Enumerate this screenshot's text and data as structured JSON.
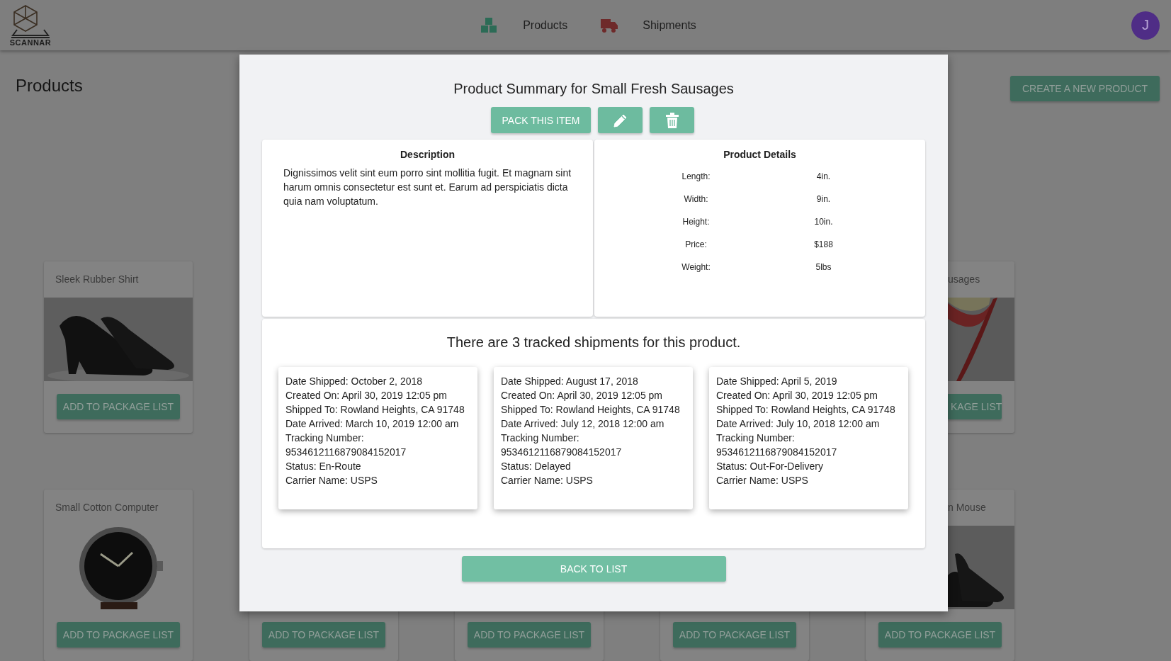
{
  "header": {
    "logo_text": "SCANNAR",
    "nav": [
      {
        "kind": "boxes",
        "label": "Products"
      },
      {
        "kind": "truck",
        "label": "Shipments"
      }
    ],
    "avatar": "J"
  },
  "page": {
    "title": "Products",
    "create_button": "CREATE A NEW PRODUCT"
  },
  "card_rows": [
    {
      "cards": [
        {
          "kind": "full",
          "title": "Sleek Rubber Shirt",
          "button": "ADD TO PACKAGE LIST",
          "button_clipped": false
        },
        {
          "kind": "right_clipped",
          "title": "usages",
          "button": "KAGE LIST",
          "button_clipped": true
        }
      ]
    },
    {
      "cards": [
        {
          "kind": "full",
          "title": "Small Cotton Computer",
          "button": "ADD TO PACKAGE LIST",
          "button_clipped": false
        },
        {
          "kind": "bottom_visible",
          "button": "ADD TO PACKAGE LIST",
          "button_clipped": false
        },
        {
          "kind": "bottom_visible",
          "button": "ADD TO PACKAGE LIST",
          "button_clipped": false
        },
        {
          "kind": "bottom_visible",
          "button": "ADD TO PACKAGE LIST",
          "button_clipped": false
        },
        {
          "kind": "right_clipped",
          "title": "n Mouse",
          "button": "ADD TO PACKAGE LIST",
          "button_clipped": false
        }
      ]
    }
  ],
  "modal": {
    "title": "Product Summary for Small Fresh Sausages",
    "actions": [
      {
        "kind": "text",
        "label": "PACK THIS ITEM"
      },
      {
        "kind": "edit"
      },
      {
        "kind": "delete"
      }
    ],
    "description": {
      "heading": "Description",
      "text": "Dignissimos velit sint eum porro sint mollitia fugit. Et magnam sint harum omnis consectetur est sunt et. Earum ad perspiciatis dicta quia nam voluptatum."
    },
    "details": {
      "heading": "Product Details",
      "rows": [
        {
          "label": "Length:",
          "value": "4in."
        },
        {
          "label": "Width:",
          "value": "9in."
        },
        {
          "label": "Height:",
          "value": "10in."
        },
        {
          "label": "Price:",
          "value": "$188"
        },
        {
          "label": "Weight:",
          "value": "5lbs"
        }
      ]
    },
    "shipments": {
      "heading": "There are 3 tracked shipments for this product.",
      "items": [
        {
          "lines": [
            "Date Shipped: October 2, 2018",
            "Created On: April 30, 2019 12:05 pm",
            "Shipped To: Rowland Heights, CA 91748",
            "Date Arrived: March 10, 2019 12:00 am",
            "Tracking Number:",
            "9534612116879084152017",
            "Status: En-Route",
            "Carrier Name: USPS"
          ]
        },
        {
          "lines": [
            "Date Shipped: August 17, 2018",
            "Created On: April 30, 2019 12:05 pm",
            "Shipped To: Rowland Heights, CA 91748",
            "Date Arrived: July 12, 2018 12:00 am",
            "Tracking Number:",
            "9534612116879084152017",
            "Status: Delayed",
            "Carrier Name: USPS"
          ]
        },
        {
          "lines": [
            "Date Shipped: April 5, 2019",
            "Created On: April 30, 2019 12:05 pm",
            "Shipped To: Rowland Heights, CA 91748",
            "Date Arrived: July 10, 2018 12:00 am",
            "Tracking Number:",
            "9534612116879084152017",
            "Status: Out-For-Delivery",
            "Carrier Name: USPS"
          ]
        }
      ]
    },
    "back_button": "BACK TO LIST"
  }
}
